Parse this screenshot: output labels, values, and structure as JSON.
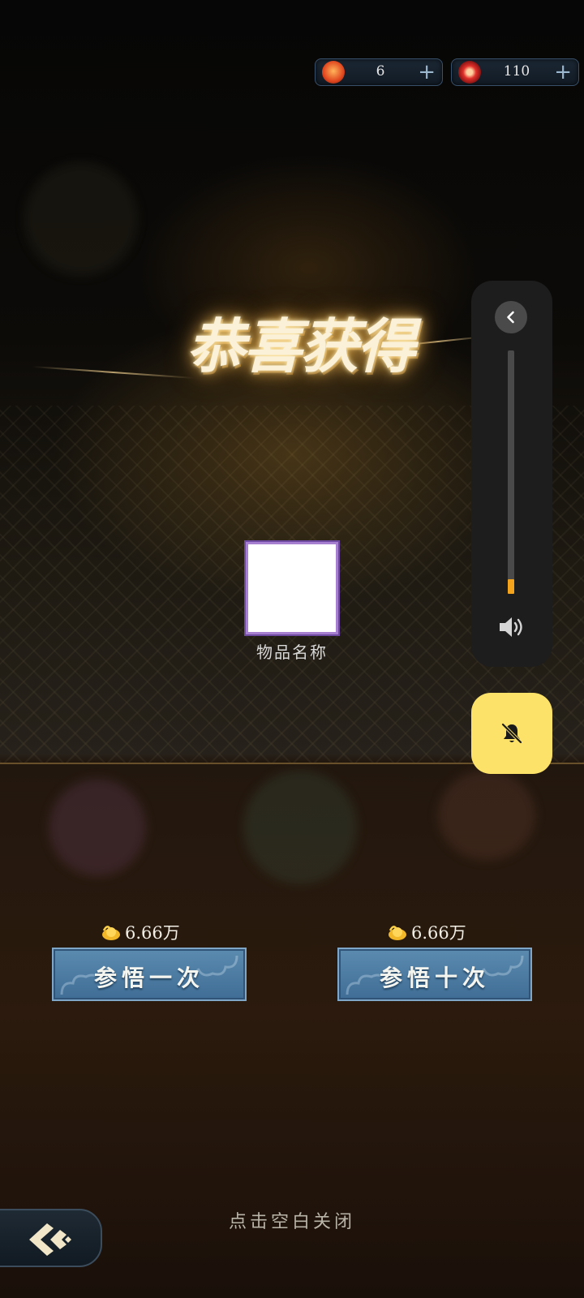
{
  "currency": {
    "lantern": {
      "icon": "lantern-icon",
      "value": "6"
    },
    "flower": {
      "icon": "red-flower-icon",
      "value": "110"
    }
  },
  "reward": {
    "title": "恭喜获得",
    "item_name": "物品名称"
  },
  "volume": {
    "level": 0.06,
    "accent_color": "#f3a31c"
  },
  "actions": {
    "single": {
      "cost": "6.66万",
      "label": "参悟一次"
    },
    "ten": {
      "cost": "6.66万",
      "label": "参悟十次"
    }
  },
  "close_hint": "点击空白关闭"
}
